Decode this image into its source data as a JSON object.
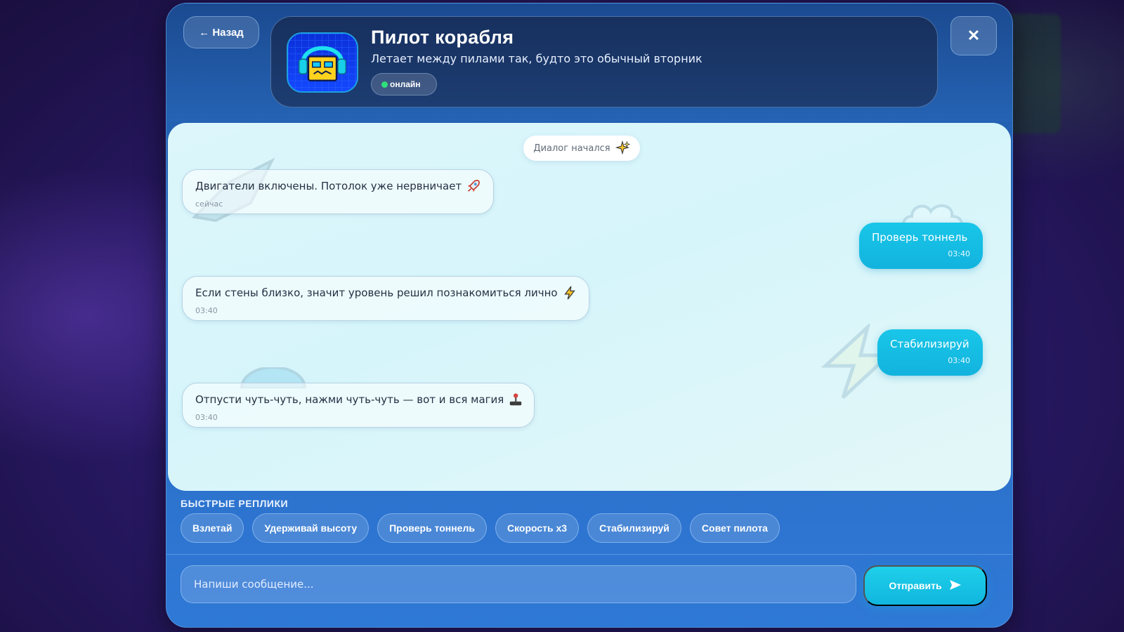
{
  "nav": {
    "back_label": "← Назад",
    "close_label": "✕"
  },
  "profile": {
    "name": "Пилот корабля",
    "description": "Летает между пилами так, будто это обычный вторник",
    "status": "онлайн",
    "avatar_icon": "headphones-cube-icon"
  },
  "chat": {
    "system_message": "Диалог начался",
    "system_icon": "sparkles-icon",
    "messages": [
      {
        "from": "bot",
        "text": "Двигатели включены. Потолок уже нервничает",
        "icon": "rocket-icon",
        "time": "сейчас"
      },
      {
        "from": "user",
        "text": "Проверь тоннель",
        "time": "03:40"
      },
      {
        "from": "bot",
        "text": "Если стены близко, значит уровень решил познакомиться лично",
        "icon": "lightning-icon",
        "time": "03:40"
      },
      {
        "from": "user",
        "text": "Стабилизируй",
        "time": "03:40"
      },
      {
        "from": "bot",
        "text": "Отпусти чуть-чуть, нажми чуть-чуть — вот и вся магия",
        "icon": "joystick-icon",
        "time": "03:40"
      }
    ]
  },
  "quick_replies": {
    "title": "БЫСТРЫЕ РЕПЛИКИ",
    "items": [
      "Взлетай",
      "Удерживай высоту",
      "Проверь тоннель",
      "Скорость x3",
      "Стабилизируй",
      "Совет пилота"
    ]
  },
  "composer": {
    "placeholder": "Напиши сообщение...",
    "send_label": "Отправить",
    "send_icon": "send-arrow-icon"
  },
  "colors": {
    "accent": "#14bde2",
    "online": "#2fe07a",
    "panel": "#2563b4",
    "chat_bg": "#dcf6fb"
  }
}
